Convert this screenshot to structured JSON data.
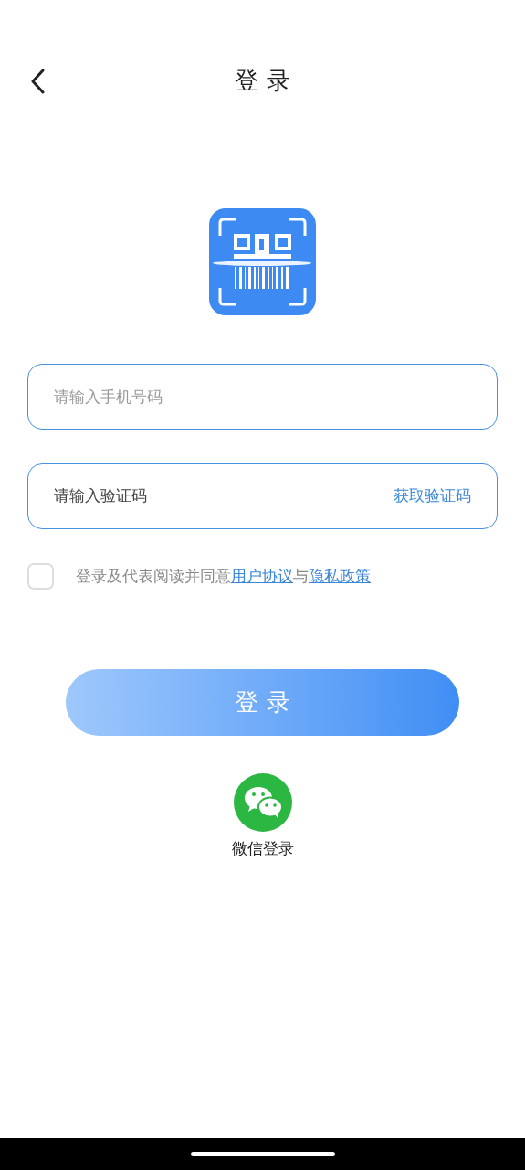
{
  "header": {
    "title": "登 录"
  },
  "phone_field": {
    "placeholder": "请输入手机号码"
  },
  "code_field": {
    "placeholder": "请输入验证码",
    "action": "获取验证码"
  },
  "agreement": {
    "checked": false,
    "parts": [
      {
        "kind": "text",
        "text": "登录及代表阅读并同意"
      },
      {
        "kind": "link",
        "text": "用户协议"
      },
      {
        "kind": "text",
        "text": "与"
      },
      {
        "kind": "link",
        "text": "隐私政策"
      }
    ]
  },
  "login_button": {
    "label": "登 录"
  },
  "wechat_login": {
    "label": "微信登录"
  }
}
